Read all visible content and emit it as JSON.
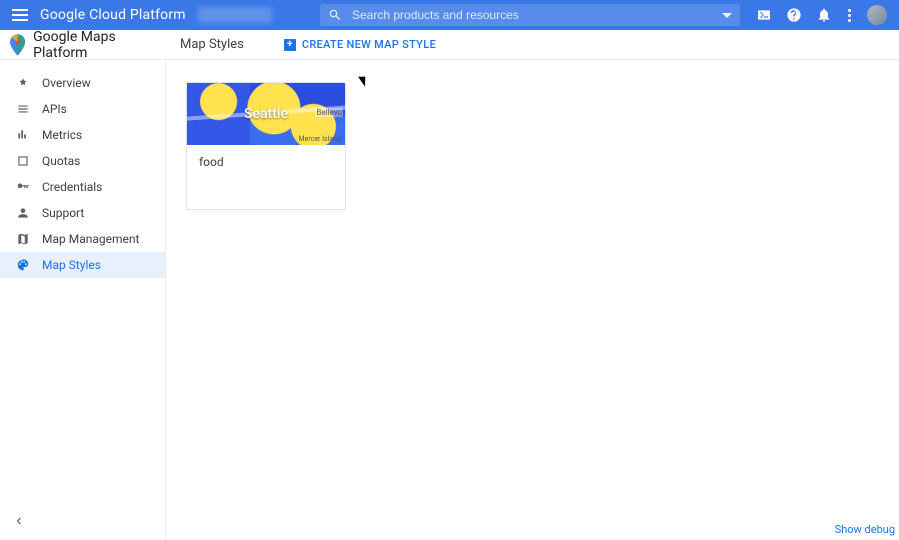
{
  "header": {
    "brand": "Google Cloud Platform",
    "search_placeholder": "Search products and resources"
  },
  "subheader": {
    "product_title": "Google Maps Platform",
    "page_title": "Map Styles",
    "create_button": "CREATE NEW MAP STYLE"
  },
  "sidebar": {
    "items": [
      {
        "label": "Overview"
      },
      {
        "label": "APIs"
      },
      {
        "label": "Metrics"
      },
      {
        "label": "Quotas"
      },
      {
        "label": "Credentials"
      },
      {
        "label": "Support"
      },
      {
        "label": "Map Management"
      },
      {
        "label": "Map Styles"
      }
    ]
  },
  "cards": [
    {
      "title": "food",
      "map_city_label": "Seattle",
      "map_right_label": "Bellevu",
      "map_bottom_label": "Mercer Island"
    }
  ],
  "footer": {
    "debug_link": "Show debug"
  }
}
